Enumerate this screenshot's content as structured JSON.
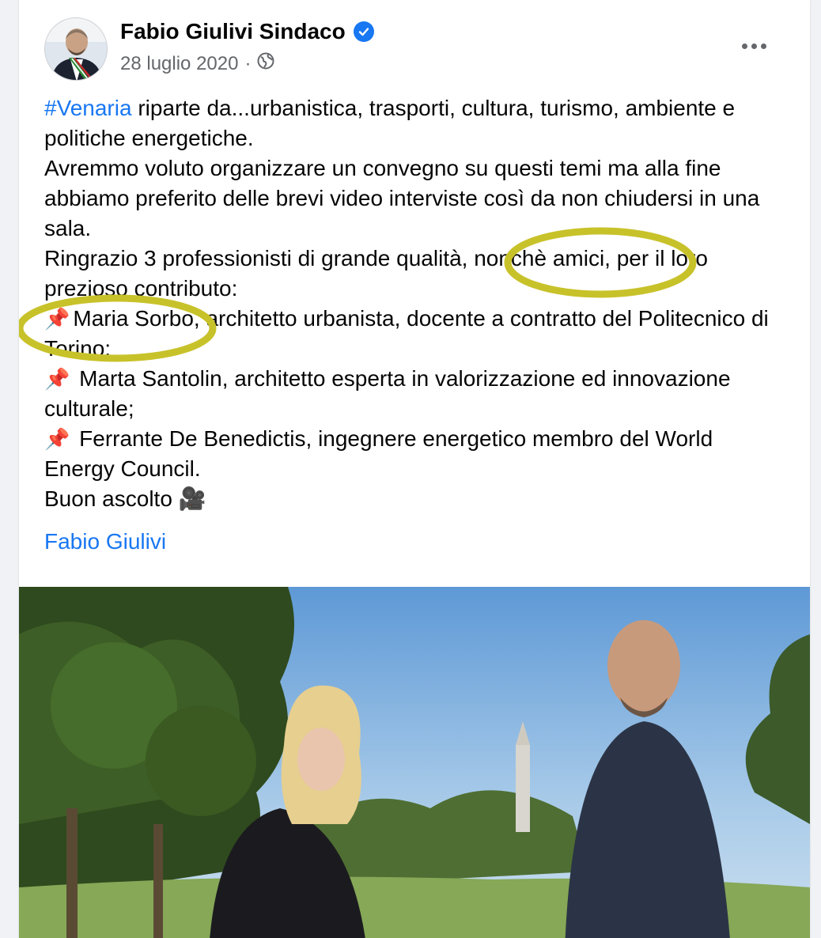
{
  "post": {
    "author": "Fabio Giulivi Sindaco",
    "date": "28 luglio 2020",
    "date_separator": "·",
    "privacy_icon": "globe-icon",
    "verified_icon": "verified-badge-icon",
    "more_icon": "more-options-icon",
    "hashtag": "#Venaria",
    "line1_rest": " riparte da...urbanistica, trasporti, cultura, turismo, ambiente e politiche energetiche.",
    "para2": "Avremmo voluto organizzare un convegno su questi temi ma alla fine abbiamo preferito delle brevi video interviste così da non chiudersi in una sala.",
    "para3": "Ringrazio 3 professionisti di grande qualità, nonchè amici, per il loro prezioso contributo:",
    "pin_glyph": "📌",
    "bullets": [
      "Maria Sorbo, architetto urbanista, docente a contratto del Politecnico di Torino;",
      " Marta Santolin, architetto esperta in valorizzazione ed innovazione culturale;",
      " Ferrante De Benedictis, ingegnere energetico membro del World Energy Council."
    ],
    "closing": "Buon ascolto 🎥",
    "signature_link": "Fabio Giulivi"
  },
  "colors": {
    "link_blue": "#1877f2",
    "meta_gray": "#65676b",
    "highlight_ellipse": "#c8c22a"
  }
}
